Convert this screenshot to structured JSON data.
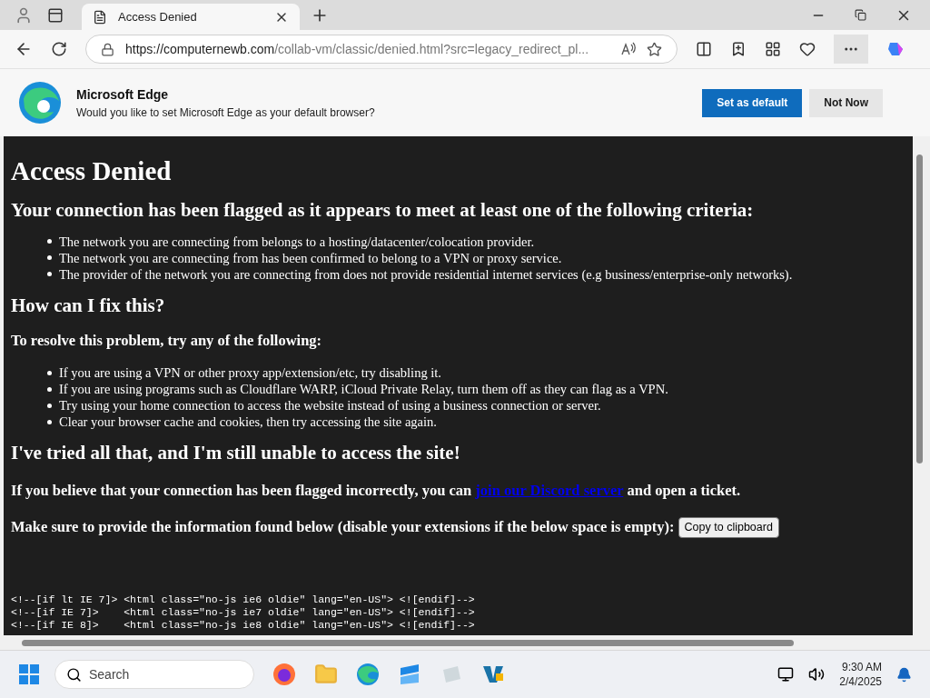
{
  "tab": {
    "title": "Access Denied"
  },
  "address_bar": {
    "url_host": "https://computernewb.com",
    "url_path": "/collab-vm/classic/denied.html?src=legacy_redirect_pl..."
  },
  "infobar": {
    "title": "Microsoft Edge",
    "message": "Would you like to set Microsoft Edge as your default browser?",
    "buttons": [
      {
        "label": "Set as default",
        "kind": "primary"
      },
      {
        "label": "Not Now",
        "kind": "secondary"
      }
    ]
  },
  "page": {
    "title": "Access Denied",
    "criteria_heading": "Your connection has been flagged as it appears to meet at least one of the following criteria:",
    "criteria": [
      "The network you are connecting from belongs to a hosting/datacenter/colocation provider.",
      "The network you are connecting from has been confirmed to belong to a VPN or proxy service.",
      "The provider of the network you are connecting from does not provide residential internet services (e.g business/enterprise-only networks)."
    ],
    "fix_heading": "How can I fix this?",
    "fix_subheading": "To resolve this problem, try any of the following:",
    "fixes": [
      "If you are using a VPN or other proxy app/extension/etc, try disabling it.",
      "If you are using programs such as Cloudflare WARP, iCloud Private Relay, turn them off as they can flag as a VPN.",
      "Try using your home connection to access the website instead of using a business connection or server.",
      "Clear your browser cache and cookies, then try accessing the site again."
    ],
    "still_heading": "I've tried all that, and I'm still unable to access the site!",
    "flagged_text_before": "If you believe that your connection has been flagged incorrectly, you can",
    "flagged_link": "join our Discord server",
    "flagged_text_after": "and open a ticket.",
    "info_text": "Make sure to provide the information found below (disable your extensions if the below space is empty):",
    "copy_button": "Copy to clipboard",
    "code_lines": [
      "<!--[if lt IE 7]> <html class=\"no-js ie6 oldie\" lang=\"en-US\"> <![endif]-->",
      "<!--[if IE 7]>    <html class=\"no-js ie7 oldie\" lang=\"en-US\"> <![endif]-->",
      "<!--[if IE 8]>    <html class=\"no-js ie8 oldie\" lang=\"en-US\"> <![endif]-->"
    ]
  },
  "taskbar": {
    "search_placeholder": "Search",
    "time": "9:30 AM",
    "date": "2/4/2025"
  }
}
